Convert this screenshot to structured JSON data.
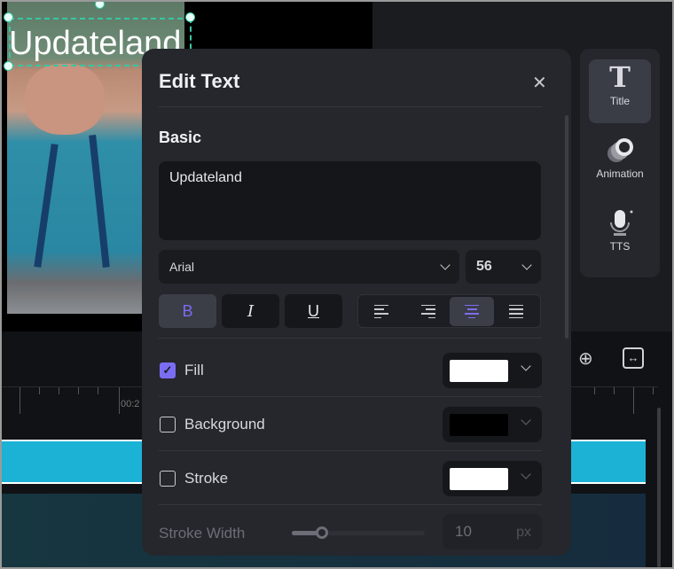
{
  "preview": {
    "overlay_text": "Updateland"
  },
  "timeline": {
    "ruler_label": "00:2"
  },
  "side_panel": {
    "items": [
      {
        "label": "Title",
        "icon": "title-t-icon",
        "active": true
      },
      {
        "label": "Animation",
        "icon": "animation-circles-icon",
        "active": false
      },
      {
        "label": "TTS",
        "icon": "microphone-icon",
        "active": false
      }
    ]
  },
  "dialog": {
    "title": "Edit Text",
    "section": "Basic",
    "text_value": "Updateland",
    "font": "Arial",
    "font_size": "56",
    "format": {
      "bold": "B",
      "italic": "I",
      "underline": "U",
      "bold_active": true
    },
    "alignment_active": "center",
    "fill": {
      "label": "Fill",
      "checked": true,
      "color": "#ffffff"
    },
    "background": {
      "label": "Background",
      "checked": false,
      "color": "#000000"
    },
    "stroke": {
      "label": "Stroke",
      "checked": false,
      "color": "#ffffff"
    },
    "stroke_width": {
      "label": "Stroke Width",
      "value": "10",
      "unit": "px"
    }
  },
  "colors": {
    "accent": "#7b6df2",
    "selection": "#35c7a3",
    "track": "#1cb2d6"
  }
}
